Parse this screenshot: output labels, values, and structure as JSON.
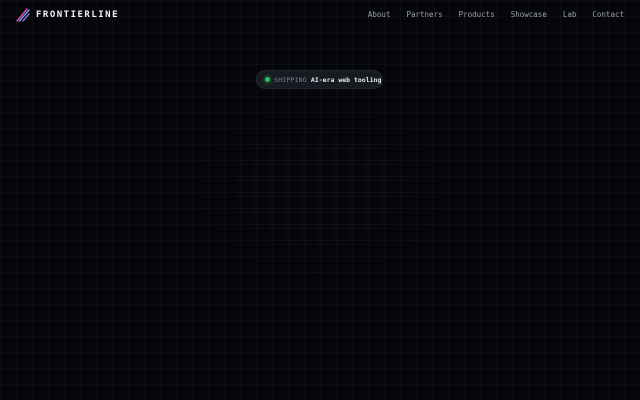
{
  "brand": {
    "name": "FRONTIERLINE",
    "logo_icon": "diagonal-stripes-logo-icon"
  },
  "nav": {
    "items": [
      {
        "label": "About"
      },
      {
        "label": "Partners"
      },
      {
        "label": "Products"
      },
      {
        "label": "Showcase"
      },
      {
        "label": "Lab"
      },
      {
        "label": "Contact"
      }
    ]
  },
  "badge": {
    "status": "SHIPPING",
    "text": "AI-era web tooling",
    "status_color": "#22c55e"
  },
  "colors": {
    "background": "#050609",
    "logo_pink": "#ec4899",
    "logo_blue": "#60a5fa",
    "logo_purple": "#a78bfa"
  }
}
